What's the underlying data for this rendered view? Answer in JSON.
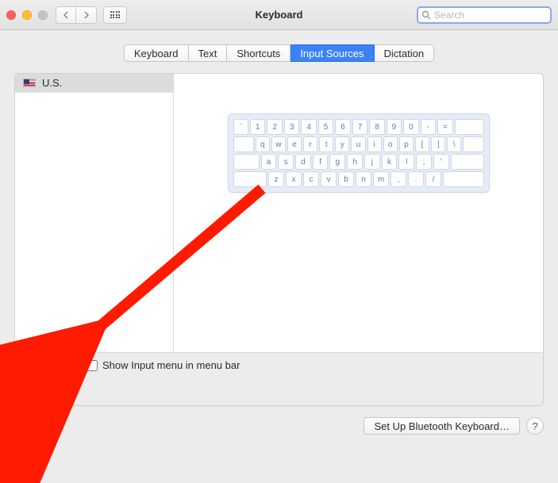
{
  "titlebar": {
    "title": "Keyboard",
    "search_placeholder": "Search"
  },
  "tabs": [
    {
      "label": "Keyboard",
      "active": false
    },
    {
      "label": "Text",
      "active": false
    },
    {
      "label": "Shortcuts",
      "active": false
    },
    {
      "label": "Input Sources",
      "active": true
    },
    {
      "label": "Dictation",
      "active": false
    }
  ],
  "sources": [
    {
      "flag": "us",
      "label": "U.S.",
      "selected": true
    }
  ],
  "keyboard_rows": [
    [
      "`",
      "1",
      "2",
      "3",
      "4",
      "5",
      "6",
      "7",
      "8",
      "9",
      "0",
      "-",
      "="
    ],
    [
      "q",
      "w",
      "e",
      "r",
      "t",
      "y",
      "u",
      "i",
      "o",
      "p",
      "[",
      "]",
      "\\"
    ],
    [
      "a",
      "s",
      "d",
      "f",
      "g",
      "h",
      "j",
      "k",
      "l",
      ";",
      "'"
    ],
    [
      "z",
      "x",
      "c",
      "v",
      "b",
      "n",
      "m",
      ",",
      ".",
      "/"
    ]
  ],
  "footer": {
    "add_label": "+",
    "remove_label": "−",
    "show_menu_label": "Show Input menu in menu bar",
    "show_menu_checked": false
  },
  "bottom": {
    "bluetooth_label": "Set Up Bluetooth Keyboard…",
    "help_label": "?"
  }
}
